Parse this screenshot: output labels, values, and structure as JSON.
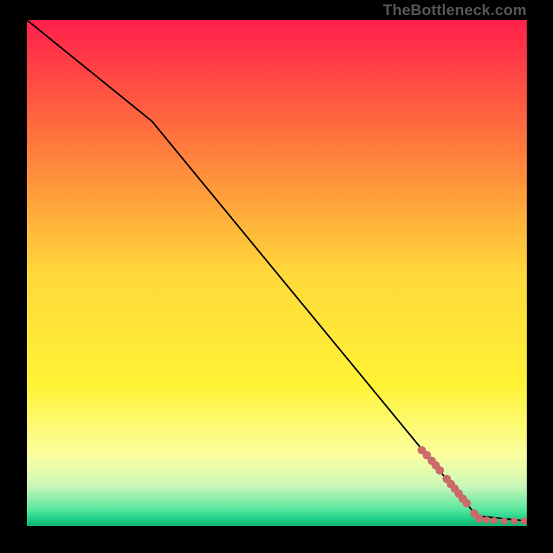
{
  "watermark": "TheBottleneck.com",
  "colors": {
    "line": "#000000",
    "marker": "#cc6969",
    "bg_black": "#000000"
  },
  "chart_data": {
    "type": "line",
    "title": "",
    "xlabel": "",
    "ylabel": "",
    "xlim": [
      0,
      100
    ],
    "ylim": [
      0,
      100
    ],
    "gradient_stops": [
      {
        "offset": 0.0,
        "color": "#ff1f4b"
      },
      {
        "offset": 0.25,
        "color": "#ff7a3c"
      },
      {
        "offset": 0.5,
        "color": "#ffd83a"
      },
      {
        "offset": 0.72,
        "color": "#fff335"
      },
      {
        "offset": 0.86,
        "color": "#fbffa0"
      },
      {
        "offset": 0.92,
        "color": "#ccf7b8"
      },
      {
        "offset": 0.965,
        "color": "#5fe8a0"
      },
      {
        "offset": 0.985,
        "color": "#22d28b"
      },
      {
        "offset": 1.0,
        "color": "#0ab06f"
      }
    ],
    "series": [
      {
        "name": "curve",
        "x": [
          0,
          25,
          90,
          100
        ],
        "y": [
          100,
          80,
          2,
          1
        ]
      }
    ],
    "markers": [
      {
        "x": 79.0,
        "y": 15.0,
        "r": 1.2
      },
      {
        "x": 80.0,
        "y": 14.0,
        "r": 1.2
      },
      {
        "x": 81.0,
        "y": 12.9,
        "r": 1.2
      },
      {
        "x": 81.8,
        "y": 12.0,
        "r": 1.2
      },
      {
        "x": 82.6,
        "y": 11.0,
        "r": 1.2
      },
      {
        "x": 84.0,
        "y": 9.3,
        "r": 1.2
      },
      {
        "x": 84.8,
        "y": 8.3,
        "r": 1.2
      },
      {
        "x": 85.6,
        "y": 7.4,
        "r": 1.2
      },
      {
        "x": 86.4,
        "y": 6.4,
        "r": 1.2
      },
      {
        "x": 87.2,
        "y": 5.4,
        "r": 1.2
      },
      {
        "x": 88.0,
        "y": 4.5,
        "r": 1.2
      },
      {
        "x": 89.5,
        "y": 2.5,
        "r": 1.2
      },
      {
        "x": 90.5,
        "y": 1.5,
        "r": 1.2
      },
      {
        "x": 92.0,
        "y": 1.2,
        "r": 1.0
      },
      {
        "x": 93.5,
        "y": 1.1,
        "r": 1.0
      },
      {
        "x": 95.5,
        "y": 1.0,
        "r": 1.0
      },
      {
        "x": 97.5,
        "y": 1.0,
        "r": 1.0
      },
      {
        "x": 99.5,
        "y": 1.0,
        "r": 1.0
      }
    ]
  }
}
